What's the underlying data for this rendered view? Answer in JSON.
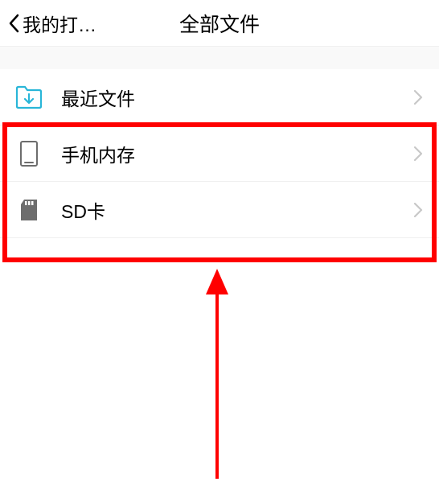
{
  "header": {
    "back_label": "我的打…",
    "title": "全部文件"
  },
  "list": {
    "items": [
      {
        "label": "最近文件"
      },
      {
        "label": "手机内存"
      },
      {
        "label": "SD卡"
      }
    ]
  },
  "colors": {
    "accent": "#29b6d8",
    "muted_icon": "#6d6d6d",
    "chevron": "#c8c8c8"
  }
}
